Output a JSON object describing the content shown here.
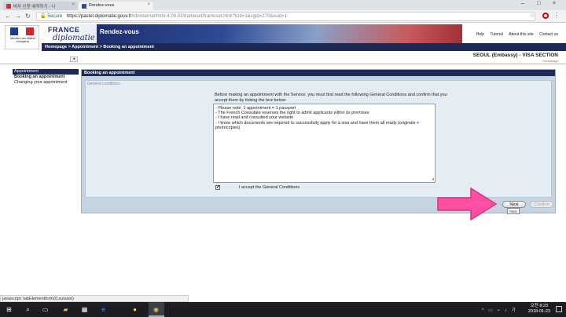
{
  "browser": {
    "tabs": [
      {
        "label": "비자 신청 예약하기 - 나"
      },
      {
        "label": "Rendez-vous"
      }
    ],
    "secure_label": "Secure",
    "url_host": "https://pastel.diplomatie.gouv.fr",
    "url_path": "/rdvinternet/html-4.00.03/frameset/frameset.html?lcid=1&sgid=270&suid=1",
    "window_controls": [
      "–",
      "□",
      "×"
    ],
    "nav_icons": [
      "back-icon",
      "forward-icon",
      "reload-icon"
    ],
    "status_text": "javascript: tabElementform(0,suivant)"
  },
  "site": {
    "emblem_text": "Ministère des Affaires étrangères",
    "brand_line1": "FRANCE",
    "brand_line2": "diplomatie",
    "banner_title": "Rendez-vous",
    "top_links": [
      "Help",
      "Tutorial",
      "About this site",
      "Contact us"
    ],
    "breadcrumb": "Homepage > Appointment > Booking an appointment",
    "section_title": "SEOUL (Embassy) - VISA SECTION",
    "homepage_link": "Homepage",
    "flag_colors": [
      "#1f3a93",
      "#ffffff",
      "#d1262e"
    ]
  },
  "sidebar": {
    "title": "Appointment",
    "items": [
      {
        "label": "Booking an appointment",
        "active": true
      },
      {
        "label": "Changing your appointment",
        "active": false
      }
    ]
  },
  "main": {
    "panel_title": "Booking an appointment",
    "fieldset_legend": "General conditions",
    "intro": "Before making an appointment with the Service, you must first read the following General Conditions and confirm that you accept them by ticking the box below:",
    "conditions": [
      "- Please note: 1 appointment = 1 passport",
      "- The French Consulate reserves the right to admit applicants within its premises",
      "- I have read and consulted your website",
      "- I know which documents are required to successfully apply for a visa and have them all ready (originals + photocopies)"
    ],
    "accept_checked_mark": "✔",
    "accept_label": "I accept the General Conditions",
    "next_label": "Next",
    "confirm_label": "Confirm",
    "tooltip": "Next"
  },
  "taskbar": {
    "time": "오전 8:23",
    "date": "2018-01-23",
    "icons": [
      "windows-icon",
      "search-icon",
      "task-view-icon",
      "file-explorer-icon",
      "store-icon",
      "edge-icon",
      "kakaotalk-icon",
      "chrome-icon"
    ],
    "accent": "#ff4fa3"
  }
}
